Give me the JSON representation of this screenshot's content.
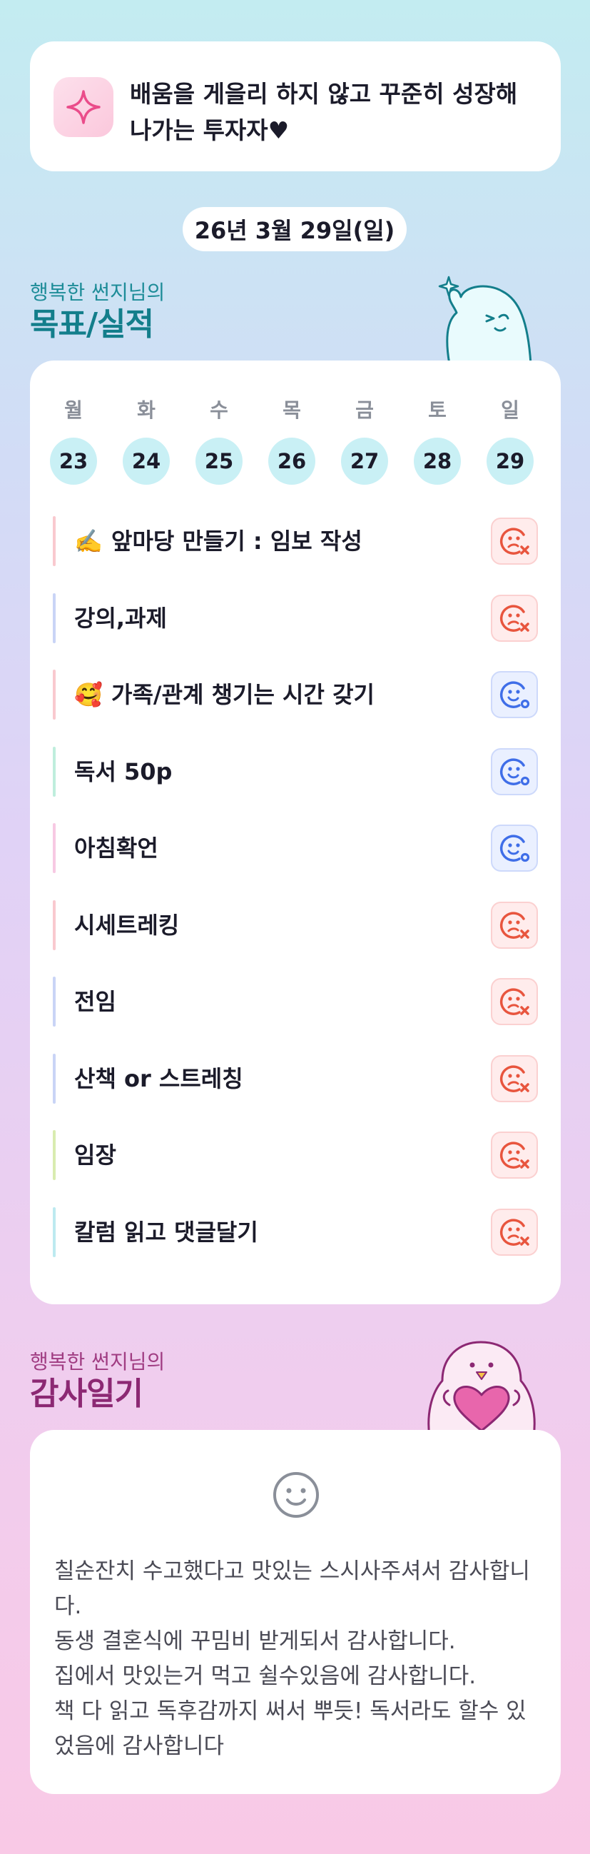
{
  "motto": {
    "icon": "sparkle-icon",
    "text": "배움을 게을리 하지 않고 꾸준히 성장해 나가는 투자자♥"
  },
  "date_label": "26년 3월 29일(일)",
  "goals_section": {
    "subtitle": "행복한 썬지님의",
    "title": "목표/실적"
  },
  "week": [
    {
      "name": "월",
      "num": "23"
    },
    {
      "name": "화",
      "num": "24"
    },
    {
      "name": "수",
      "num": "25"
    },
    {
      "name": "목",
      "num": "26"
    },
    {
      "name": "금",
      "num": "27"
    },
    {
      "name": "토",
      "num": "28"
    },
    {
      "name": "일",
      "num": "29"
    }
  ],
  "goals": [
    {
      "emoji": "✍️",
      "label": "앞마당 만들기 : 임보 작성",
      "status": "fail",
      "bar_color": "#f9c9cf"
    },
    {
      "emoji": "",
      "label": "강의,과제",
      "status": "fail",
      "bar_color": "#c9d4f6"
    },
    {
      "emoji": "🥰",
      "label": "가족/관계 챙기는 시간 갖기",
      "status": "ok",
      "bar_color": "#f9c9cf"
    },
    {
      "emoji": "",
      "label": "독서 50p",
      "status": "ok",
      "bar_color": "#bfeedd"
    },
    {
      "emoji": "",
      "label": "아침확언",
      "status": "ok",
      "bar_color": "#f7c9e3"
    },
    {
      "emoji": "",
      "label": "시세트레킹",
      "status": "fail",
      "bar_color": "#f9c9cf"
    },
    {
      "emoji": "",
      "label": "전임",
      "status": "fail",
      "bar_color": "#c9d4f6"
    },
    {
      "emoji": "",
      "label": "산책 or 스트레칭",
      "status": "fail",
      "bar_color": "#c9d4f6"
    },
    {
      "emoji": "",
      "label": "임장",
      "status": "fail",
      "bar_color": "#d9ecb0"
    },
    {
      "emoji": "",
      "label": "칼럼 읽고 댓글달기",
      "status": "fail",
      "bar_color": "#bdeaf0"
    }
  ],
  "thanks_section": {
    "subtitle": "행복한 썬지님의",
    "title": "감사일기",
    "lines": [
      "칠순잔치 수고했다고 맛있는 스시사주셔서 감사합니다.",
      "동생 결혼식에 꾸밈비 받게되서 감사합니다.",
      "집에서 맛있는거 먹고 쉴수있음에 감사합니다.",
      "책 다 읽고 독후감까지 써서 뿌듯! 독서라도 할수 있었음에 감사합니다"
    ]
  },
  "colors": {
    "fail": "#e8553e",
    "ok": "#3f6ee8",
    "day_circle": "#c9f0f5"
  }
}
